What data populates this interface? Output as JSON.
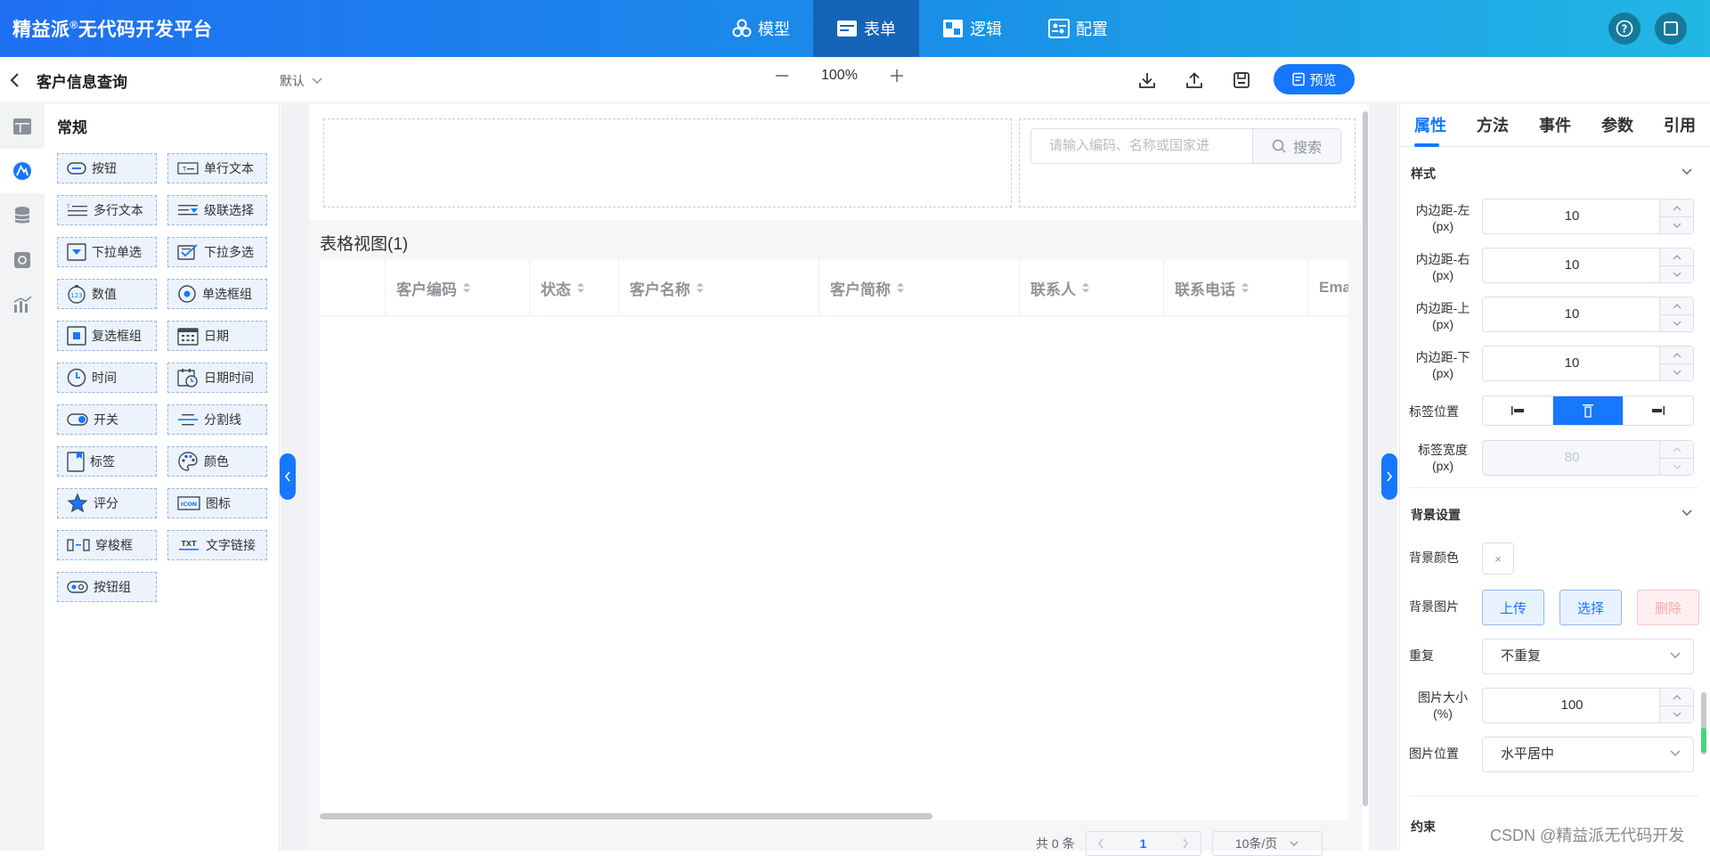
{
  "app": {
    "brand": "精益派",
    "brand_mark": "®",
    "brand_suffix": "无代码开发平台"
  },
  "nav": [
    {
      "label": "模型",
      "icon": "cubes-icon",
      "active": false
    },
    {
      "label": "表单",
      "icon": "form-icon",
      "active": true
    },
    {
      "label": "逻辑",
      "icon": "logic-icon",
      "active": false
    },
    {
      "label": "配置",
      "icon": "config-icon",
      "active": false
    }
  ],
  "toolbar": {
    "title": "客户信息查询",
    "view": "默认",
    "zoom": "100%",
    "preview": "预览"
  },
  "components": {
    "title": "常规",
    "items": [
      {
        "label": "按钮",
        "icon": "button-icon"
      },
      {
        "label": "单行文本",
        "icon": "text-input-icon"
      },
      {
        "label": "多行文本",
        "icon": "textarea-icon"
      },
      {
        "label": "级联选择",
        "icon": "cascader-icon"
      },
      {
        "label": "下拉单选",
        "icon": "select-icon"
      },
      {
        "label": "下拉多选",
        "icon": "multi-select-icon"
      },
      {
        "label": "数值",
        "icon": "number-icon"
      },
      {
        "label": "单选框组",
        "icon": "radio-icon"
      },
      {
        "label": "复选框组",
        "icon": "checkbox-icon"
      },
      {
        "label": "日期",
        "icon": "calendar-icon"
      },
      {
        "label": "时间",
        "icon": "clock-icon"
      },
      {
        "label": "日期时间",
        "icon": "datetime-icon"
      },
      {
        "label": "开关",
        "icon": "switch-icon"
      },
      {
        "label": "分割线",
        "icon": "divider-icon"
      },
      {
        "label": "标签",
        "icon": "tag-icon"
      },
      {
        "label": "颜色",
        "icon": "palette-icon"
      },
      {
        "label": "评分",
        "icon": "star-icon"
      },
      {
        "label": "图标",
        "icon": "icon-icon"
      },
      {
        "label": "穿梭框",
        "icon": "transfer-icon"
      },
      {
        "label": "文字链接",
        "icon": "text-link-icon"
      },
      {
        "label": "按钮组",
        "icon": "button-group-icon"
      }
    ]
  },
  "canvas": {
    "search_placeholder": "请输入编码、名称或国家进",
    "search_label": "搜索",
    "table_title": "表格视图(1)",
    "columns": [
      "客户编码",
      "状态",
      "客户名称",
      "客户简称",
      "联系人",
      "联系电话",
      "Ema"
    ],
    "total": "共 0 条",
    "page": "1",
    "page_size": "10条/页"
  },
  "props": {
    "tabs": [
      "属性",
      "方法",
      "事件",
      "参数",
      "引用"
    ],
    "style_section": "样式",
    "padding_left_label": "内边距-左",
    "padding_right_label": "内边距-右",
    "padding_top_label": "内边距-上",
    "padding_bottom_label": "内边距-下",
    "unit_px": "(px)",
    "padding_left": "10",
    "padding_right": "10",
    "padding_top": "10",
    "padding_bottom": "10",
    "label_position_label": "标签位置",
    "label_width_label": "标签宽度",
    "label_width": "80",
    "bg_section": "背景设置",
    "bg_color_label": "背景颜色",
    "bg_color_empty": "×",
    "bg_image_label": "背景图片",
    "upload": "上传",
    "choose": "选择",
    "delete": "删除",
    "repeat_label": "重复",
    "repeat_value": "不重复",
    "img_size_label": "图片大小",
    "unit_pct": "(%)",
    "img_size": "100",
    "img_pos_label": "图片位置",
    "img_pos_value": "水平居中",
    "next_section": "约束"
  },
  "colors": {
    "accent": "#1677ff",
    "danger": "#f56c6c"
  },
  "watermark": "CSDN @精益派无代码开发"
}
